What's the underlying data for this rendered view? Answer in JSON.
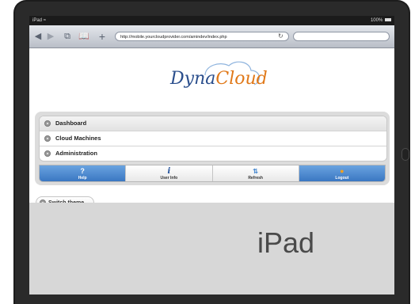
{
  "status_bar": {
    "device": "iPad",
    "wifi_icon": "wifi-icon",
    "battery": "100%"
  },
  "browser": {
    "url": "http://mobile.yourcloudprovider.com/amindev/index.php",
    "search_placeholder": "",
    "icons": [
      "back-icon",
      "forward-icon",
      "tabs-icon",
      "bookmarks-icon",
      "add-icon",
      "reload-icon"
    ]
  },
  "logo": {
    "part1": "Dyna",
    "part2": "Cloud",
    "colors": {
      "primary": "#2a4e8c",
      "accent": "#e07818"
    }
  },
  "menu": {
    "items": [
      {
        "label": "Dashboard"
      },
      {
        "label": "Cloud Machines"
      },
      {
        "label": "Administration"
      }
    ]
  },
  "nav": {
    "buttons": [
      {
        "label": "Help",
        "icon": "help-icon",
        "active": true
      },
      {
        "label": "User Info",
        "icon": "info-icon",
        "active": false
      },
      {
        "label": "Refresh",
        "icon": "refresh-icon",
        "active": false
      },
      {
        "label": "Logout",
        "icon": "lock-icon",
        "active": true
      }
    ],
    "active_color": "#3a77c2"
  },
  "switch_theme": {
    "label": "Switch theme"
  },
  "caption": {
    "text": "iPad"
  }
}
